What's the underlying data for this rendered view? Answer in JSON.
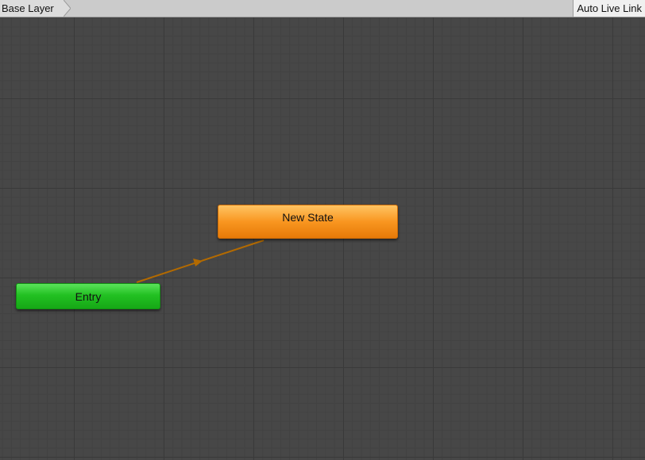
{
  "toolbar": {
    "breadcrumb": [
      {
        "label": "Base Layer"
      }
    ],
    "live_link_label": "Auto Live Link"
  },
  "graph": {
    "states": {
      "entry": {
        "label": "Entry",
        "color": "#22c122",
        "kind": "entry"
      },
      "new_state": {
        "label": "New State",
        "color": "#f99620",
        "kind": "default-state"
      }
    },
    "transitions": [
      {
        "from": "Entry",
        "to": "New State",
        "color": "#b36a00"
      }
    ],
    "background_color": "#474747"
  }
}
